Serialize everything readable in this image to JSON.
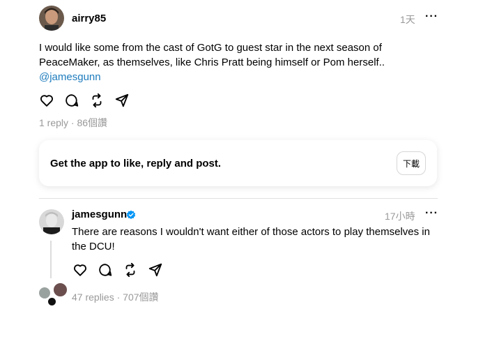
{
  "post1": {
    "username": "airry85",
    "time": "1天",
    "more": "···",
    "text": "I would like some from the cast of GotG to guest star in the next season of PeaceMaker, as themselves, like Chris Pratt being himself or Pom herself..",
    "mention": "@jamesgunn",
    "replies": "1 reply",
    "sep": "·",
    "views": "86個讚"
  },
  "app_card": {
    "text": "Get the app to like, reply and post.",
    "button": "下載"
  },
  "post2": {
    "username": "jamesgunn",
    "time": "17小時",
    "more": "···",
    "text": "There are reasons I wouldn't want either of those actors to play themselves in the DCU!",
    "replies": "47 replies",
    "sep": "·",
    "views": "707個讚"
  },
  "icons": [
    "heart-icon",
    "comment-icon",
    "repost-icon",
    "share-icon",
    "verified-badge-icon"
  ],
  "colors": {
    "mention": "#1d7bbd",
    "verified": "#0095f6",
    "muted": "#999999"
  }
}
